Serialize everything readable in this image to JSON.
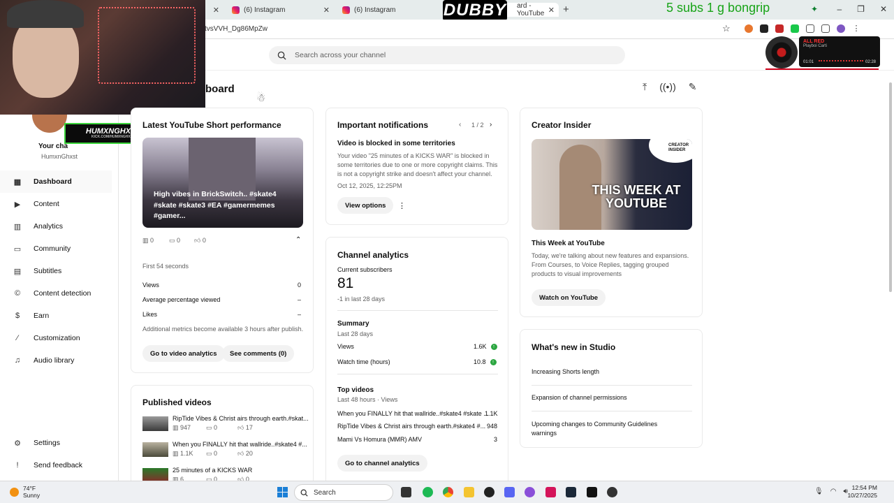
{
  "browser": {
    "tabs": [
      {
        "label": "(6) Instagram"
      },
      {
        "label": "(6) Instagram"
      },
      {
        "label": "ard - YouTube"
      }
    ],
    "url": "tvsVVH_Dg86MpZw"
  },
  "stream_overlay": {
    "title_badge": "DUBBY",
    "subs_goal": "5 subs 1 g bongrip",
    "nameplate": "HUMXNGHXST",
    "nameplate_sub": "KICK.COM/HUMXNGHXST",
    "music": {
      "track": "ALL RED",
      "artist": "Playboi Carti",
      "elapsed": "01:01",
      "total": "02:28"
    }
  },
  "studio": {
    "search_placeholder": "Search across your channel",
    "page_title": "board",
    "channel_name": "Your cha",
    "channel_handle": "HumxnGhxst",
    "nav": [
      {
        "label": "Dashboard",
        "icon": "dashboard-icon"
      },
      {
        "label": "Content",
        "icon": "content-icon"
      },
      {
        "label": "Analytics",
        "icon": "analytics-icon"
      },
      {
        "label": "Community",
        "icon": "community-icon"
      },
      {
        "label": "Subtitles",
        "icon": "subtitles-icon"
      },
      {
        "label": "Content detection",
        "icon": "copyright-icon"
      },
      {
        "label": "Earn",
        "icon": "dollar-icon"
      },
      {
        "label": "Customization",
        "icon": "wand-icon"
      },
      {
        "label": "Audio library",
        "icon": "audio-library-icon"
      }
    ],
    "nav_bottom": [
      {
        "label": "Settings",
        "icon": "gear-icon"
      },
      {
        "label": "Send feedback",
        "icon": "feedback-icon"
      }
    ]
  },
  "short_card": {
    "title": "Latest YouTube Short performance",
    "video_title": "High vibes in BrickSwitch.. #skate4 #skate #skate3 #EA #gamermemes #gamer...",
    "views": "0",
    "comments": "0",
    "likes": "0",
    "period": "First 54 seconds",
    "metrics": [
      {
        "label": "Views",
        "value": "0"
      },
      {
        "label": "Average percentage viewed",
        "value": "–"
      },
      {
        "label": "Likes",
        "value": "–"
      }
    ],
    "note": "Additional metrics become available 3 hours after publish.",
    "btn_analytics": "Go to video analytics",
    "btn_comments": "See comments (0)"
  },
  "published": {
    "title": "Published videos",
    "videos": [
      {
        "title": "RipTide Vibes & Christ airs through earth.#skat...",
        "views": "947",
        "comments": "0",
        "likes": "17"
      },
      {
        "title": "When you FINALLY hit that wallride..#skate4 #...",
        "views": "1.1K",
        "comments": "0",
        "likes": "20"
      },
      {
        "title": "25 minutes of a KICKS WAR",
        "views": "6",
        "comments": "0",
        "likes": "0"
      }
    ]
  },
  "notifications": {
    "title": "Important notifications",
    "pager": "1 / 2",
    "heading": "Video is blocked in some territories",
    "body": "Your video \"25 minutes of a KICKS WAR\" is blocked in some territories due to one or more copyright claims. This is not a copyright strike and doesn't affect your channel.",
    "date": "Oct 12, 2025, 12:25PM",
    "btn": "View options"
  },
  "channel_analytics": {
    "title": "Channel analytics",
    "subs_label": "Current subscribers",
    "subs_value": "81",
    "subs_change_value": "-1",
    "subs_change_text": " in last 28 days",
    "summary_title": "Summary",
    "summary_period": "Last 28 days",
    "summary_rows": [
      {
        "label": "Views",
        "value": "1.6K"
      },
      {
        "label": "Watch time (hours)",
        "value": "10.8"
      }
    ],
    "top_title": "Top videos",
    "top_period": "Last 48 hours · Views",
    "top_rows": [
      {
        "label": "When you FINALLY hit that wallride..#skate4 #skate ...",
        "value": "1.1K"
      },
      {
        "label": "RipTide Vibes & Christ airs through earth.#skate4 #...",
        "value": "948"
      },
      {
        "label": "Mami Vs Homura (MMR) AMV",
        "value": "3"
      }
    ],
    "btn": "Go to channel analytics"
  },
  "creator_insider": {
    "title": "Creator Insider",
    "badge": "CREATOR INSIDER",
    "thumb_text": "THIS WEEK AT YOUTUBE",
    "video_title": "This Week at YouTube",
    "desc": "Today, we're talking about new features and expansions. From Courses, to Voice Replies, tagging grouped products to visual improvements",
    "btn": "Watch on YouTube"
  },
  "whats_new": {
    "title": "What's new in Studio",
    "items": [
      "Increasing Shorts length",
      "Expansion of channel permissions",
      "Upcoming changes to Community Guidelines warnings"
    ]
  },
  "taskbar": {
    "temp": "74°F",
    "condition": "Sunny",
    "search": "Search",
    "time": "12:54 PM",
    "date": "10/27/2025"
  }
}
